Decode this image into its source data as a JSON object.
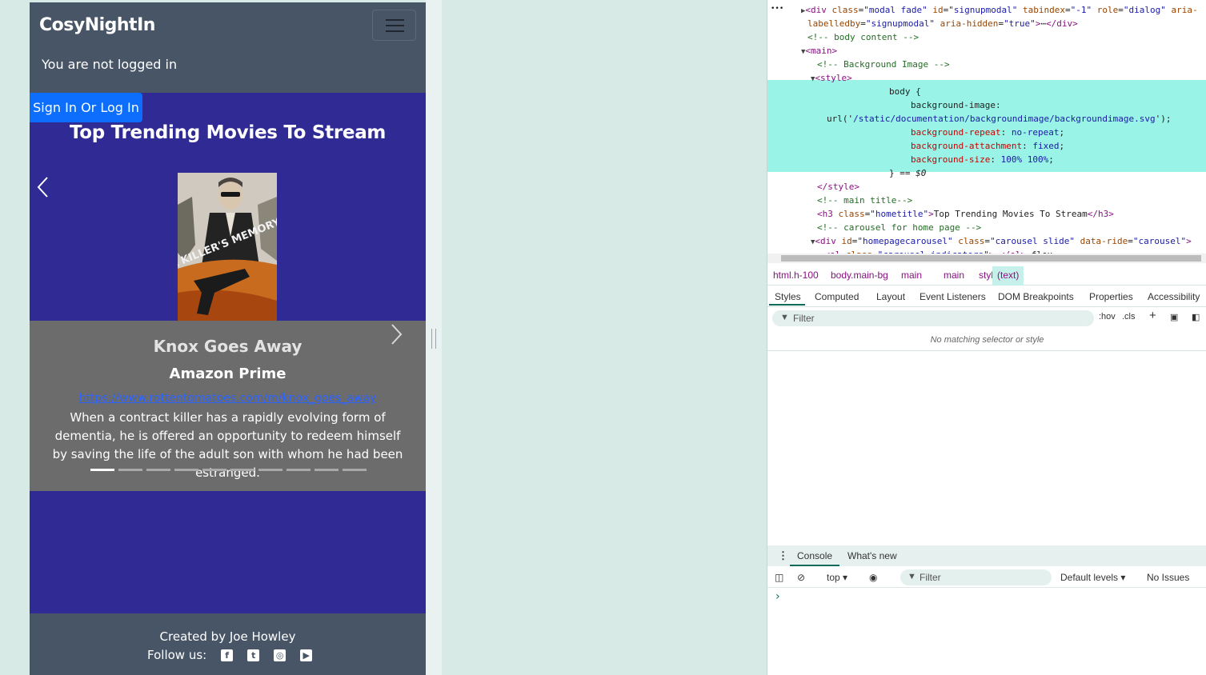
{
  "app": {
    "brand": "CosyNightIn",
    "login_status": "You are not logged in",
    "signin_label": "Sign In Or Log In",
    "page_title": "Top Trending Movies To Stream"
  },
  "carousel": {
    "poster_text": "A KILLER'S MEMORY",
    "movie_title": "Knox Goes Away",
    "platform": "Amazon Prime",
    "link": "https://www.rottentomatoes.com/m/knox_goes_away",
    "description": "When a contract killer has a rapidly evolving form of dementia, he is offered an opportunity to redeem himself by saving the life of the adult son with whom he had been estranged.",
    "slide_count": 10,
    "active_slide": 1
  },
  "footer": {
    "credit": "Created by Joe Howley",
    "follow_label": "Follow us:",
    "social_icons": [
      "facebook-icon",
      "twitter-icon",
      "instagram-icon",
      "youtube-icon"
    ]
  },
  "devtools": {
    "elements_lines": [
      {
        "html": "<span class=\"tri\">▶</span><span class=\"tag\">&lt;div</span> <span class=\"attr\">class</span>=<span class=\"val\">\"modal fade\"</span> <span class=\"attr\">id</span>=<span class=\"val\">\"signupmodal\"</span> <span class=\"attr\">tabindex</span>=<span class=\"val\">\"-1\"</span> <span class=\"attr\">role</span>=<span class=\"val\">\"dialog\"</span> <span class=\"attr\">aria-</span>"
      },
      {
        "html": "<span class=\"attr\">labelledby</span>=<span class=\"val\">\"signupmodal\"</span> <span class=\"attr\">aria-hidden</span>=<span class=\"val\">\"true\"</span><span class=\"tag\">&gt;</span>⋯<span class=\"tag\">&lt;/div&gt;</span>"
      },
      {
        "html": "<span class=\"cmt\">&lt;!-- body content --&gt;</span>"
      },
      {
        "html": "<span class=\"tri\">▼</span><span class=\"tag\">&lt;main&gt;</span>"
      },
      {
        "html": "<span class=\"cmt\">&lt;!-- Background Image --&gt;</span>"
      },
      {
        "html": "<span class=\"tri\">▼</span><span class=\"tag\">&lt;style&gt;</span>"
      },
      {
        "html": "body {"
      },
      {
        "html": "background-image:"
      },
      {
        "html": "url('<span class=\"val\">/static/documentation/backgroundimage/backgroundimage.svg</span>');"
      },
      {
        "html": "<span class=\"prop\">background-repeat</span>: <span class=\"val\">no-repeat</span>;"
      },
      {
        "html": "<span class=\"prop\">background-attachment</span>: <span class=\"val\">fixed</span>;"
      },
      {
        "html": "<span class=\"prop\">background-size</span>: <span class=\"val\">100% 100%</span>;"
      },
      {
        "html": "} == <i>$0</i>"
      },
      {
        "html": "<span class=\"tag\">&lt;/style&gt;</span>"
      },
      {
        "html": "<span class=\"cmt\">&lt;!-- main title--&gt;</span>"
      },
      {
        "html": "<span class=\"tag\">&lt;h3</span> <span class=\"attr\">class</span>=<span class=\"val\">\"hometitle\"</span><span class=\"tag\">&gt;</span>Top Trending Movies To Stream<span class=\"tag\">&lt;/h3&gt;</span>"
      },
      {
        "html": "<span class=\"cmt\">&lt;!-- carousel for home page --&gt;</span>"
      },
      {
        "html": "<span class=\"tri\">▼</span><span class=\"tag\">&lt;div</span> <span class=\"attr\">id</span>=<span class=\"val\">\"homepagecarousel\"</span> <span class=\"attr\">class</span>=<span class=\"val\">\"carousel slide\"</span> <span class=\"attr\">data-ride</span>=<span class=\"val\">\"carousel\"</span><span class=\"tag\">&gt;</span>"
      },
      {
        "html": "<span class=\"tri\">▶</span><span class=\"tag\">&lt;ol</span> <span class=\"attr\">class</span>=<span class=\"val\">\"carousel-indicators\"</span><span class=\"tag\">&gt;</span>⋯<span class=\"tag\">&lt;/ol&gt;</span> flex"
      }
    ],
    "breadcrumbs": [
      "html.h-100",
      "body.main-bg",
      "main",
      "main",
      "style"
    ],
    "breadcrumb_active": "(text)",
    "style_tabs": [
      "Styles",
      "Computed",
      "Layout",
      "Event Listeners",
      "DOM Breakpoints",
      "Properties",
      "Accessibility"
    ],
    "filter_placeholder": "Filter",
    "hov_label": ":hov",
    "cls_label": ".cls",
    "no_match": "No matching selector or style",
    "drawer_tabs": [
      "Console",
      "What's new"
    ],
    "console_context": "top",
    "console_filter": "Filter",
    "levels": "Default levels",
    "issues": "No Issues",
    "prompt": "›"
  }
}
